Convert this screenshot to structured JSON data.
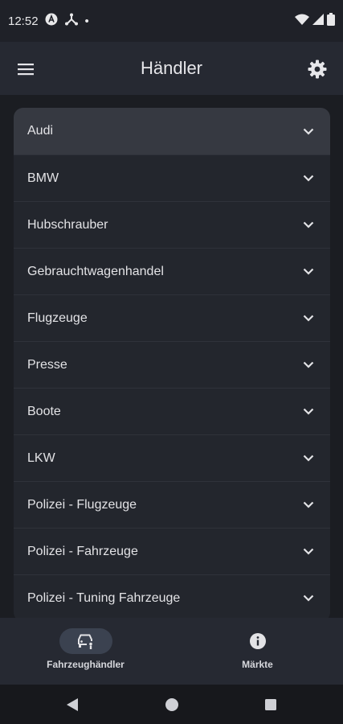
{
  "status_bar": {
    "time": "12:52",
    "dot": "•"
  },
  "app_bar": {
    "title": "Händler"
  },
  "dealers": [
    {
      "label": "Audi"
    },
    {
      "label": "BMW"
    },
    {
      "label": "Hubschrauber"
    },
    {
      "label": "Gebrauchtwagenhandel"
    },
    {
      "label": "Flugzeuge"
    },
    {
      "label": "Presse"
    },
    {
      "label": "Boote"
    },
    {
      "label": "LKW"
    },
    {
      "label": "Polizei - Flugzeuge"
    },
    {
      "label": "Polizei - Fahrzeuge"
    },
    {
      "label": "Polizei - Tuning Fahrzeuge"
    }
  ],
  "bottom_nav": {
    "items": [
      {
        "label": "Fahrzeughändler",
        "icon": "car-dealer-icon",
        "active": true
      },
      {
        "label": "Märkte",
        "icon": "info-icon",
        "active": false
      }
    ]
  },
  "colors": {
    "background": "#1b1d22",
    "surface": "#23262d",
    "app_bar": "#262932",
    "selected": "#363941"
  }
}
